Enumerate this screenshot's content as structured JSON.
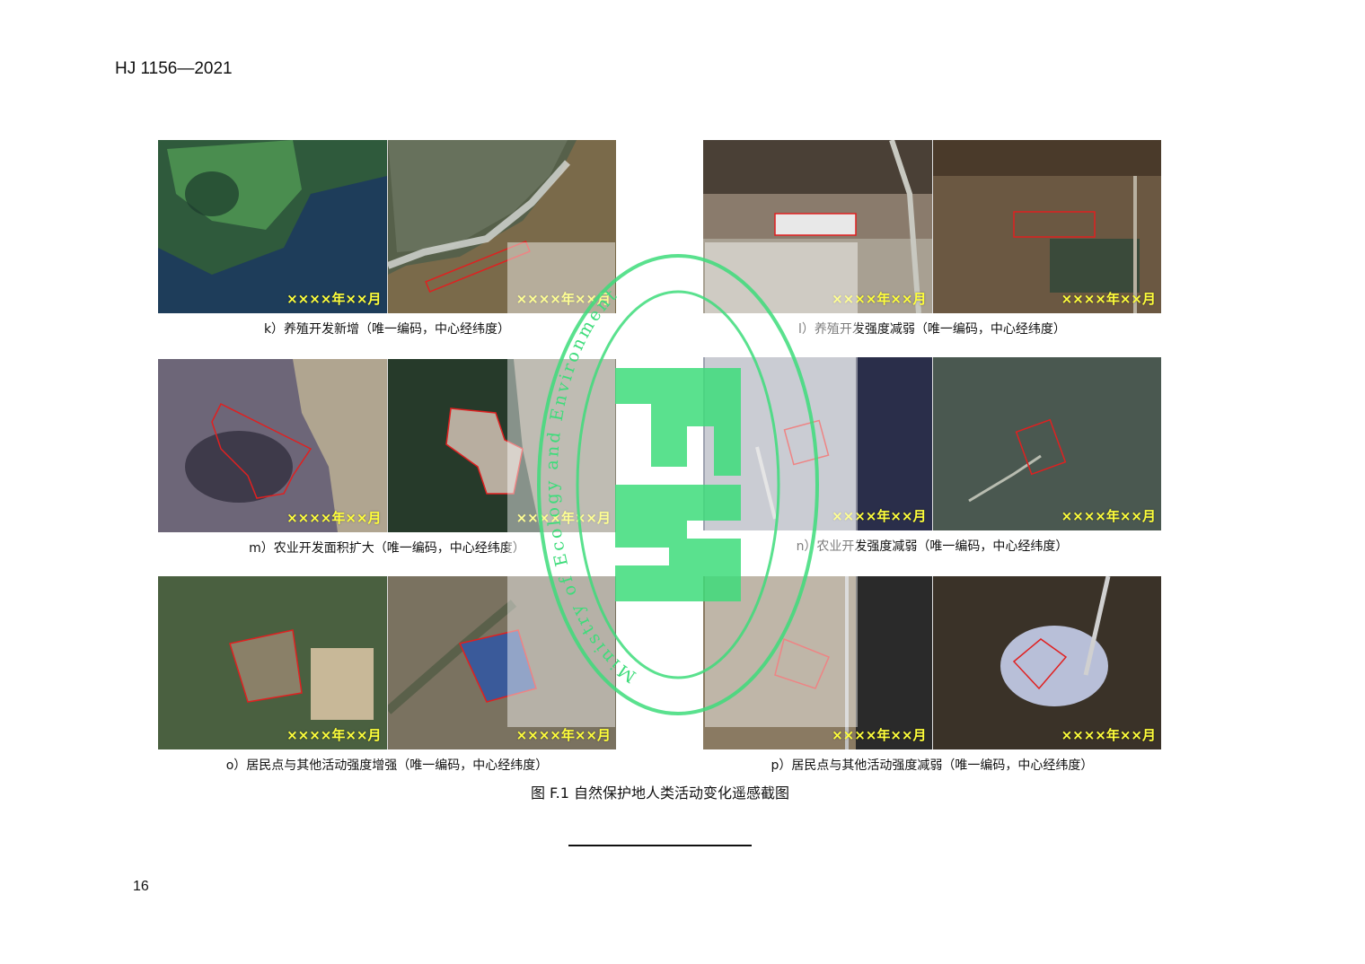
{
  "header": {
    "standard_number": "HJ 1156—2021"
  },
  "date_label": "××××年××月",
  "panels": [
    {
      "id": "k",
      "caption": "k）养殖开发新增（唯一编码，中心经纬度）"
    },
    {
      "id": "l",
      "caption": "l）养殖开发强度减弱（唯一编码，中心经纬度）"
    },
    {
      "id": "m",
      "caption": "m）农业开发面积扩大（唯一编码，中心经纬度）"
    },
    {
      "id": "n",
      "caption": "n）农业开发强度减弱（唯一编码，中心经纬度）"
    },
    {
      "id": "o",
      "caption": "o）居民点与其他活动强度增强（唯一编码，中心经纬度）"
    },
    {
      "id": "p",
      "caption": "p）居民点与其他活动强度减弱（唯一编码，中心经纬度）"
    }
  ],
  "figure_caption": "图 F.1  自然保护地人类活动变化遥感截图",
  "watermark": {
    "text": "Ministry of Ecology and Environment",
    "color": "#3ddc7a"
  },
  "page_number": "16"
}
